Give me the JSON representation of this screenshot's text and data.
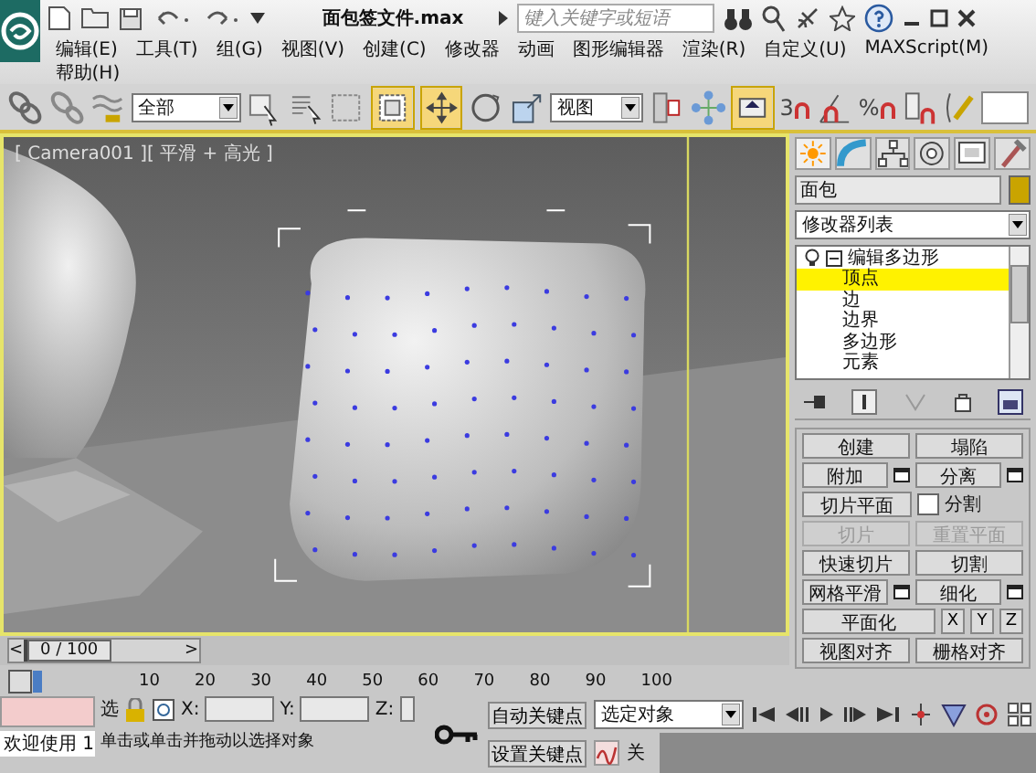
{
  "app": {
    "title": "面包签文件.max",
    "search": {
      "placeholder": "键入关键字或短语"
    }
  },
  "menu_rows": [
    [
      "编辑(E)",
      "工具(T)",
      "组(G)",
      "视图(V)",
      "创建(C)",
      "修改器",
      "动画",
      "图形编辑器",
      "渲染(R)",
      "自定义(U)",
      "MAXScript(M)"
    ],
    [
      "帮助(H)"
    ]
  ],
  "toolbar": {
    "selection_filter": "全部",
    "coordinate_system": "视图",
    "snap_label": "3",
    "percent_snap_label": "%"
  },
  "viewport": {
    "label": "[ Camera001 ][ 平滑 + 高光 ]",
    "active": true
  },
  "command_panel": {
    "object_name": "面包",
    "modifier_list": "修改器列表",
    "stack": [
      {
        "label": "编辑多边形",
        "expanded": true,
        "selected": false,
        "children": [
          {
            "label": "顶点",
            "selected": true
          },
          {
            "label": "边",
            "selected": false
          },
          {
            "label": "边界",
            "selected": false
          },
          {
            "label": "多边形",
            "selected": false
          },
          {
            "label": "元素",
            "selected": false
          }
        ]
      }
    ],
    "button_rows": [
      [
        {
          "kind": "button",
          "label": "创建",
          "disabled": false
        },
        {
          "kind": "button",
          "label": "塌陷",
          "disabled": false
        }
      ],
      [
        {
          "kind": "settings",
          "label": "附加",
          "disabled": false
        },
        {
          "kind": "settings",
          "label": "分离",
          "disabled": false
        }
      ],
      [
        {
          "kind": "button",
          "label": "切片平面",
          "disabled": false
        },
        {
          "kind": "checkbox",
          "label": "分割",
          "checked": false
        }
      ],
      [
        {
          "kind": "button",
          "label": "切片",
          "disabled": true
        },
        {
          "kind": "button",
          "label": "重置平面",
          "disabled": true
        }
      ],
      [
        {
          "kind": "button",
          "label": "快速切片",
          "disabled": false
        },
        {
          "kind": "button",
          "label": "切割",
          "disabled": false
        }
      ],
      [
        {
          "kind": "settings",
          "label": "网格平滑",
          "disabled": false
        },
        {
          "kind": "settings",
          "label": "细化",
          "disabled": false
        }
      ],
      [
        {
          "kind": "button",
          "label": "平面化",
          "disabled": false
        },
        {
          "kind": "axis",
          "label": "X"
        },
        {
          "kind": "axis",
          "label": "Y"
        },
        {
          "kind": "axis",
          "label": "Z"
        }
      ],
      [
        {
          "kind": "button",
          "label": "视图对齐",
          "disabled": false
        },
        {
          "kind": "button",
          "label": "栅格对齐",
          "disabled": false
        }
      ]
    ]
  },
  "timeline": {
    "prev": "<",
    "position": "0 / 100",
    "next": ">",
    "level": 0,
    "ticks": [
      "10",
      "20",
      "30",
      "40",
      "50",
      "60",
      "70",
      "80",
      "90",
      "100"
    ]
  },
  "status": {
    "welcome": "欢迎使用 1",
    "selection_lock": "选",
    "x_label": "X:",
    "y_label": "Y:",
    "z_label": "Z:",
    "prompt": "单击或单击并拖动以选择对象",
    "auto_key": "自动关键点",
    "key_filter": "选定对象",
    "set_key": "设置关键点",
    "key_filters": "关"
  }
}
